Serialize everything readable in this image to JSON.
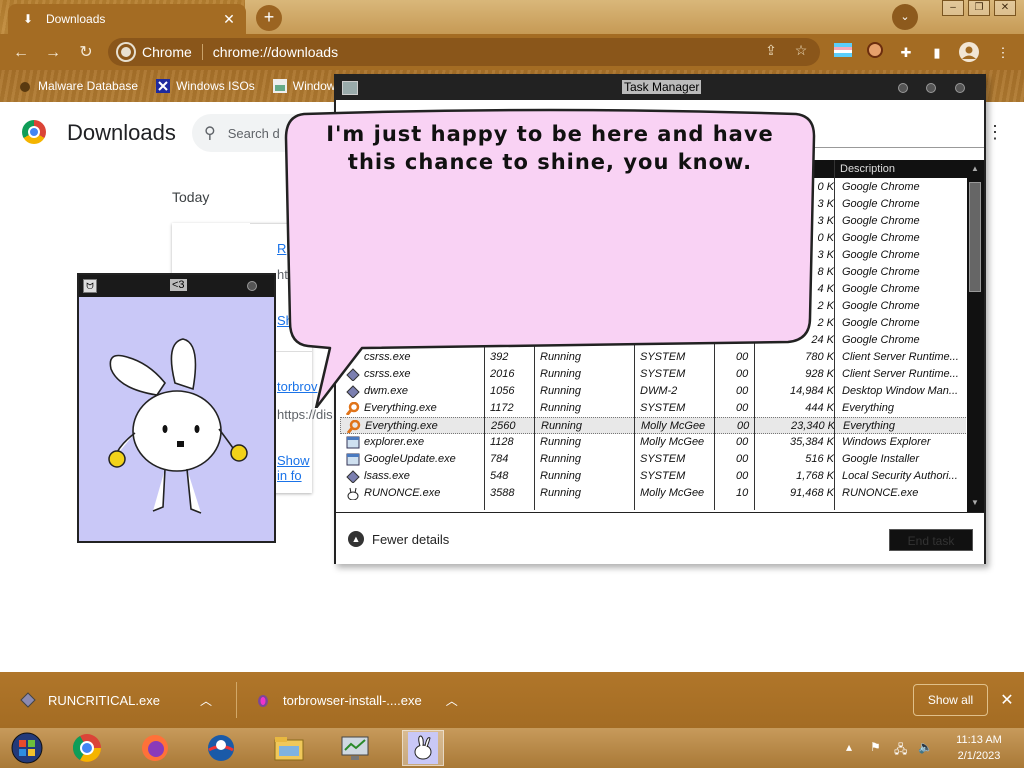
{
  "browser": {
    "tab_title": "Downloads",
    "omnibox_label": "Chrome",
    "omnibox_url": "chrome://downloads",
    "bookmarks": [
      "Malware Database",
      "Windows ISOs",
      "Windows"
    ]
  },
  "downloads_page": {
    "title": "Downloads",
    "search_placeholder": "Search d",
    "section_today": "Today",
    "card1_link": "R",
    "card1_url": "ht",
    "card1_action": "Sh",
    "card2_link": "torbrov",
    "card2_url": "https://dis",
    "card2_action": "Show in fo"
  },
  "task_manager": {
    "title": "Task Manager",
    "description_header": "Description",
    "rows": [
      {
        "name": "",
        "pid": "",
        "status": "",
        "user": "",
        "cpu": "",
        "mem": "0 K",
        "desc": "Google Chrome",
        "icon": "none"
      },
      {
        "name": "",
        "pid": "",
        "status": "",
        "user": "",
        "cpu": "",
        "mem": "3 K",
        "desc": "Google Chrome",
        "icon": "none"
      },
      {
        "name": "",
        "pid": "",
        "status": "",
        "user": "",
        "cpu": "",
        "mem": "3 K",
        "desc": "Google Chrome",
        "icon": "none"
      },
      {
        "name": "",
        "pid": "",
        "status": "",
        "user": "",
        "cpu": "",
        "mem": "0 K",
        "desc": "Google Chrome",
        "icon": "none"
      },
      {
        "name": "",
        "pid": "",
        "status": "",
        "user": "",
        "cpu": "",
        "mem": "3 K",
        "desc": "Google Chrome",
        "icon": "none"
      },
      {
        "name": "",
        "pid": "",
        "status": "",
        "user": "",
        "cpu": "",
        "mem": "8 K",
        "desc": "Google Chrome",
        "icon": "none"
      },
      {
        "name": "",
        "pid": "",
        "status": "",
        "user": "",
        "cpu": "",
        "mem": "4 K",
        "desc": "Google Chrome",
        "icon": "none"
      },
      {
        "name": "",
        "pid": "",
        "status": "",
        "user": "",
        "cpu": "",
        "mem": "2 K",
        "desc": "Google Chrome",
        "icon": "none"
      },
      {
        "name": "",
        "pid": "",
        "status": "",
        "user": "",
        "cpu": "",
        "mem": "2 K",
        "desc": "Google Chrome",
        "icon": "none"
      },
      {
        "name": "",
        "pid": "",
        "status": "",
        "user": "",
        "cpu": "",
        "mem": "24 K",
        "desc": "Google Chrome",
        "icon": "none"
      },
      {
        "name": "csrss.exe",
        "pid": "392",
        "status": "Running",
        "user": "SYSTEM",
        "cpu": "00",
        "mem": "780 K",
        "desc": "Client Server Runtime...",
        "icon": "none"
      },
      {
        "name": "csrss.exe",
        "pid": "2016",
        "status": "Running",
        "user": "SYSTEM",
        "cpu": "00",
        "mem": "928 K",
        "desc": "Client Server Runtime...",
        "icon": "diamond"
      },
      {
        "name": "dwm.exe",
        "pid": "1056",
        "status": "Running",
        "user": "DWM-2",
        "cpu": "00",
        "mem": "14,984 K",
        "desc": "Desktop Window Man...",
        "icon": "diamond"
      },
      {
        "name": "Everything.exe",
        "pid": "1172",
        "status": "Running",
        "user": "SYSTEM",
        "cpu": "00",
        "mem": "444 K",
        "desc": "Everything",
        "icon": "search"
      },
      {
        "name": "Everything.exe",
        "pid": "2560",
        "status": "Running",
        "user": "Molly McGee",
        "cpu": "00",
        "mem": "23,340 K",
        "desc": "Everything",
        "icon": "search"
      },
      {
        "name": "explorer.exe",
        "pid": "1128",
        "status": "Running",
        "user": "Molly McGee",
        "cpu": "00",
        "mem": "35,384 K",
        "desc": "Windows Explorer",
        "icon": "window"
      },
      {
        "name": "GoogleUpdate.exe",
        "pid": "784",
        "status": "Running",
        "user": "SYSTEM",
        "cpu": "00",
        "mem": "516 K",
        "desc": "Google Installer",
        "icon": "window"
      },
      {
        "name": "lsass.exe",
        "pid": "548",
        "status": "Running",
        "user": "SYSTEM",
        "cpu": "00",
        "mem": "1,768 K",
        "desc": "Local Security Authori...",
        "icon": "diamond"
      },
      {
        "name": "RUNONCE.exe",
        "pid": "3588",
        "status": "Running",
        "user": "Molly McGee",
        "cpu": "10",
        "mem": "91,468 K",
        "desc": "RUNONCE.exe",
        "icon": "bunny"
      },
      {
        "name": "",
        "pid": "",
        "status": "",
        "user": "",
        "cpu": "",
        "mem": "",
        "desc": "",
        "icon": "none"
      }
    ],
    "selected_row": 14,
    "fewer_details": "Fewer details",
    "end_task": "End task"
  },
  "speech_bubble": {
    "text": "I'm just happy to be here and have this chance to shine, you know."
  },
  "bunny_window": {
    "title": "<3"
  },
  "download_bar": {
    "items": [
      {
        "name": "RUNCRITICAL.exe"
      },
      {
        "name": "torbrowser-install-....exe"
      }
    ],
    "show_all": "Show all"
  },
  "taskbar": {
    "time": "11:13 AM",
    "date": "2/1/2023"
  },
  "colors": {
    "wood": "#a46c23",
    "bubble_fill": "#f9d2f4",
    "bunny_bg": "#c9c8f7"
  }
}
